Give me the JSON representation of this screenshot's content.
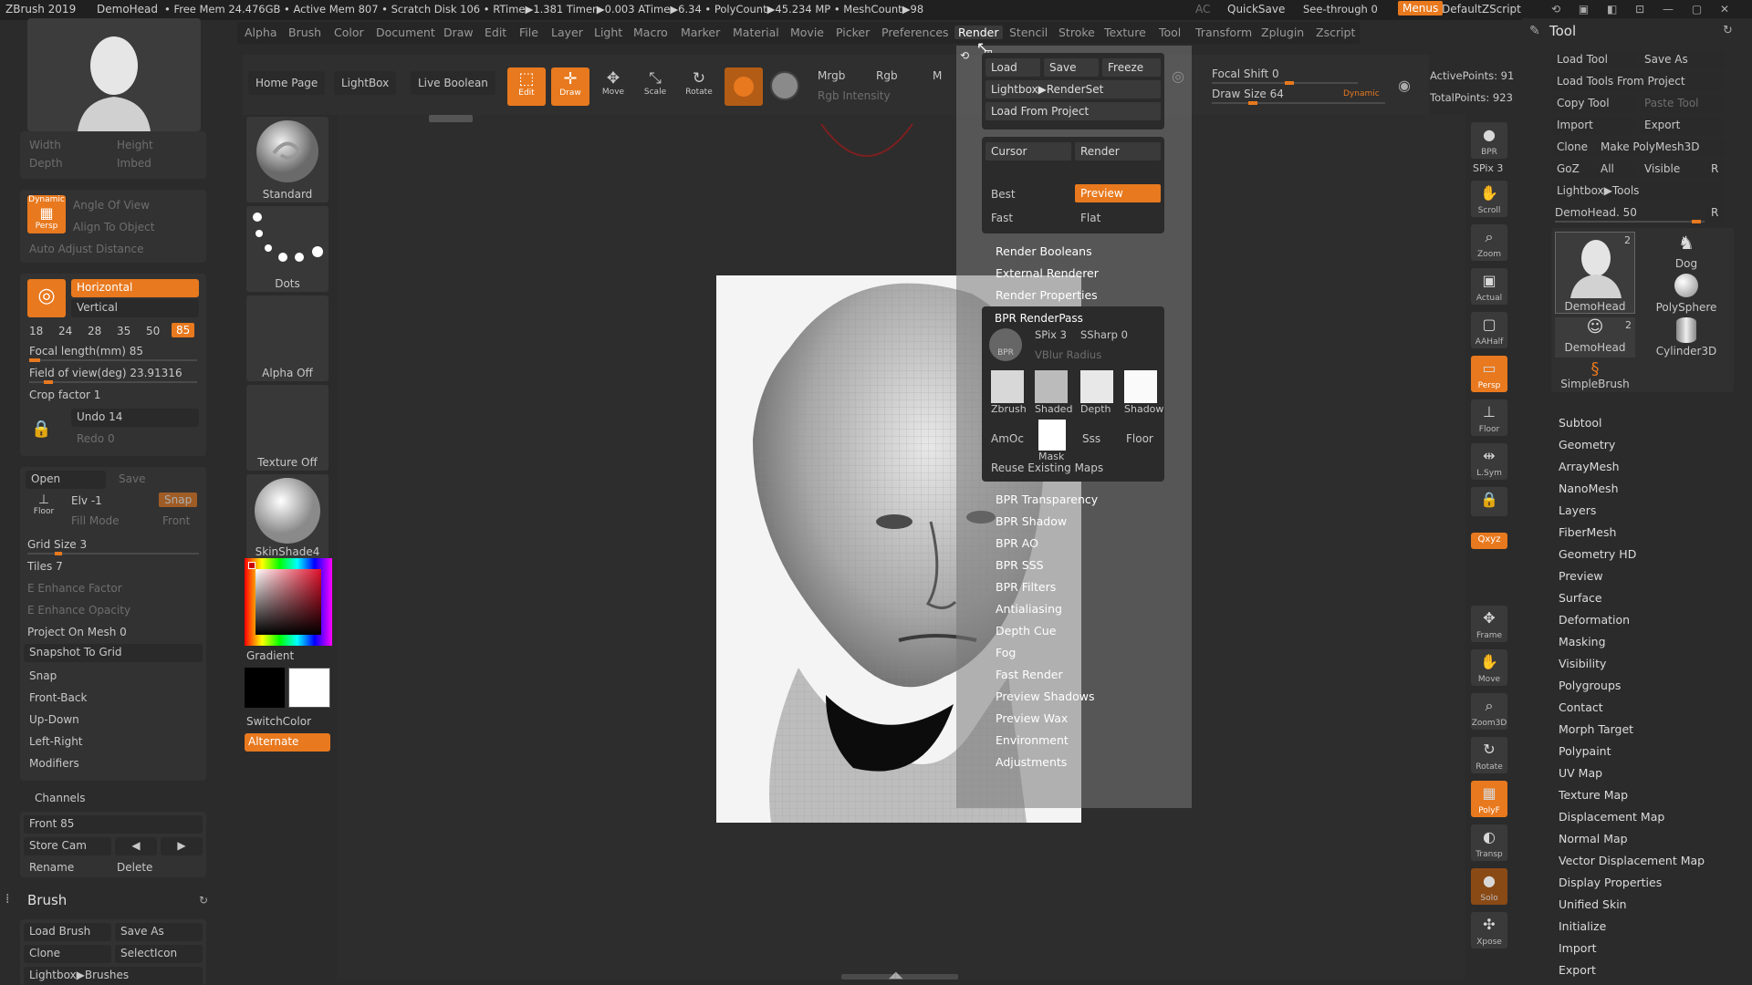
{
  "titlebar": {
    "app": "ZBrush 2019",
    "doc": "DemoHead",
    "stats": "• Free Mem 24.476GB • Active Mem 807 • Scratch Disk 106 • RTime▶1.381 Timer▶0.003 ATime▶6.34 • PolyCount▶45.234 MP • MeshCount▶98",
    "ac": "AC",
    "quicksave": "QuickSave",
    "seethrough": "See-through 0",
    "menus": "Menus",
    "script": "DefaultZScript"
  },
  "menu": [
    "Alpha",
    "Brush",
    "Color",
    "Document",
    "Draw",
    "Edit",
    "File",
    "Layer",
    "Light",
    "Macro",
    "Marker",
    "Material",
    "Movie",
    "Picker",
    "Preferences",
    "Render",
    "Stencil",
    "Stroke",
    "Texture",
    "Tool",
    "Transform",
    "Zplugin",
    "Zscript"
  ],
  "shelf": {
    "home": "Home Page",
    "lightbox": "LightBox",
    "liveboolean": "Live Boolean",
    "edit": "Edit",
    "draw": "Draw",
    "move": "Move",
    "scale": "Scale",
    "rotate": "Rotate",
    "mrgb": "Mrgb",
    "rgb": "Rgb",
    "m": "M",
    "rgbintensity": "Rgb Intensity",
    "focal": "Focal Shift 0",
    "drawsize": "Draw Size 64",
    "dynamic": "Dynamic",
    "active": "ActivePoints: 91",
    "total": "TotalPoints: 923"
  },
  "left": {
    "width": "Width",
    "height": "Height",
    "depth": "Depth",
    "imbed": "Imbed",
    "dynamic": "Dynamic",
    "persp": "Persp",
    "angle": "Angle Of View",
    "align": "Align To Object",
    "auto": "Auto Adjust Distance",
    "horizontal": "Horizontal",
    "vertical": "Vertical",
    "fl": [
      "18",
      "24",
      "28",
      "35",
      "50",
      "85"
    ],
    "focal": "Focal length(mm) 85",
    "fov": "Field of view(deg) 23.91316",
    "crop": "Crop factor 1",
    "undo": "Undo 14",
    "redo": "Redo 0",
    "open": "Open",
    "save": "Save",
    "floor": "Floor",
    "elv": "Elv -1",
    "fillmode": "Fill Mode",
    "snap": "Snap",
    "front": "Front",
    "grid": "Grid Size 3",
    "tiles": "Tiles 7",
    "efactor": "E Enhance Factor",
    "eopacity": "E Enhance Opacity",
    "project": "Project On Mesh 0",
    "snapshot": "Snapshot To Grid",
    "snap2": "Snap",
    "frontback": "Front-Back",
    "updown": "Up-Down",
    "leftright": "Left-Right",
    "modifiers": "Modifiers",
    "channels": "Channels",
    "front85": "Front 85",
    "storecam": "Store Cam",
    "rename": "Rename",
    "delete": "Delete",
    "brush": "Brush",
    "loadbrush": "Load Brush",
    "saveas": "Save As",
    "clone": "Clone",
    "selecticon": "SelectIcon",
    "lightboxbrushes": "Lightbox▶Brushes"
  },
  "brushes": {
    "standard": "Standard",
    "dots": "Dots",
    "alphaoff": "Alpha Off",
    "textureoff": "Texture Off",
    "skinshade": "SkinShade4",
    "gradient": "Gradient",
    "switchcolor": "SwitchColor",
    "alternate": "Alternate"
  },
  "render": {
    "load": "Load",
    "save": "Save",
    "freeze": "Freeze",
    "lightboxrenderset": "Lightbox▶RenderSet",
    "loadproject": "Load From Project",
    "cursor": "Cursor",
    "render": "Render",
    "best": "Best",
    "preview": "Preview",
    "fast": "Fast",
    "flat": "Flat",
    "items1": [
      "Render Booleans",
      "External Renderer",
      "Render Properties"
    ],
    "bprpass": "BPR RenderPass",
    "bpr": "BPR",
    "spix": "SPix 3",
    "ssharp": "SSharp 0",
    "vblur": "VBlur Radius",
    "passes": [
      "Zbrush",
      "Shaded",
      "Depth",
      "Shadow"
    ],
    "amoc": "AmOc",
    "mask": "Mask",
    "sss": "Sss",
    "floor": "Floor",
    "reuse": "Reuse Existing Maps",
    "items2": [
      "BPR Transparency",
      "BPR Shadow",
      "BPR AO",
      "BPR SSS",
      "BPR Filters",
      "Antialiasing",
      "Depth Cue",
      "Fog",
      "Fast Render",
      "Preview Shadows",
      "Preview Wax",
      "Environment",
      "Adjustments"
    ]
  },
  "rightbar": [
    {
      "b": "●",
      "s": "BPR"
    },
    {
      "b": "✋",
      "s": "Scroll"
    },
    {
      "b": "⌕",
      "s": "Zoom"
    },
    {
      "b": "▣",
      "s": "Actual"
    },
    {
      "b": "▢",
      "s": "AAHalf"
    },
    {
      "b": "▭",
      "s": "Persp"
    },
    {
      "b": "⊥",
      "s": "Floor"
    },
    {
      "b": "⇹",
      "s": "L.Sym"
    },
    {
      "b": "🔒",
      "s": ""
    },
    {
      "b": "✥",
      "s": "Frame"
    },
    {
      "b": "✋",
      "s": "Move"
    },
    {
      "b": "⌕",
      "s": "Zoom3D"
    },
    {
      "b": "↻",
      "s": "Rotate"
    },
    {
      "b": "▦",
      "s": "PolyF"
    },
    {
      "b": "◐",
      "s": "Transp"
    },
    {
      "b": "●",
      "s": "Solo"
    },
    {
      "b": "✣",
      "s": "Xpose"
    }
  ],
  "rb_extra": {
    "spix": "SPix 3",
    "xyz": "Qxyz"
  },
  "tool": {
    "title": "Tool",
    "loadtool": "Load Tool",
    "saveas": "Save As",
    "loadproject": "Load Tools From Project",
    "copytool": "Copy Tool",
    "pastetool": "Paste Tool",
    "import": "Import",
    "export": "Export",
    "clone": "Clone",
    "makepoly": "Make PolyMesh3D",
    "goz": "GoZ",
    "all": "All",
    "visible": "Visible",
    "r": "R",
    "lightboxtools": "Lightbox▶Tools",
    "demohead": "DemoHead. 50",
    "thumbs": [
      {
        "n": "DemoHead",
        "c": "2"
      },
      {
        "n": "Dog",
        "c": ""
      },
      {
        "n": "PolySphere",
        "c": ""
      },
      {
        "n": "DemoHead",
        "c": "2"
      },
      {
        "n": "Cylinder3D",
        "c": ""
      },
      {
        "n": "SimpleBrush",
        "c": ""
      }
    ],
    "items": [
      "Subtool",
      "Geometry",
      "ArrayMesh",
      "NanoMesh",
      "Layers",
      "FiberMesh",
      "Geometry HD",
      "Preview",
      "Surface",
      "Deformation",
      "Masking",
      "Visibility",
      "Polygroups",
      "Contact",
      "Morph Target",
      "Polypaint",
      "UV Map",
      "Texture Map",
      "Displacement Map",
      "Normal Map",
      "Vector Displacement Map",
      "Display Properties",
      "Unified Skin",
      "Initialize",
      "Import",
      "Export"
    ]
  }
}
